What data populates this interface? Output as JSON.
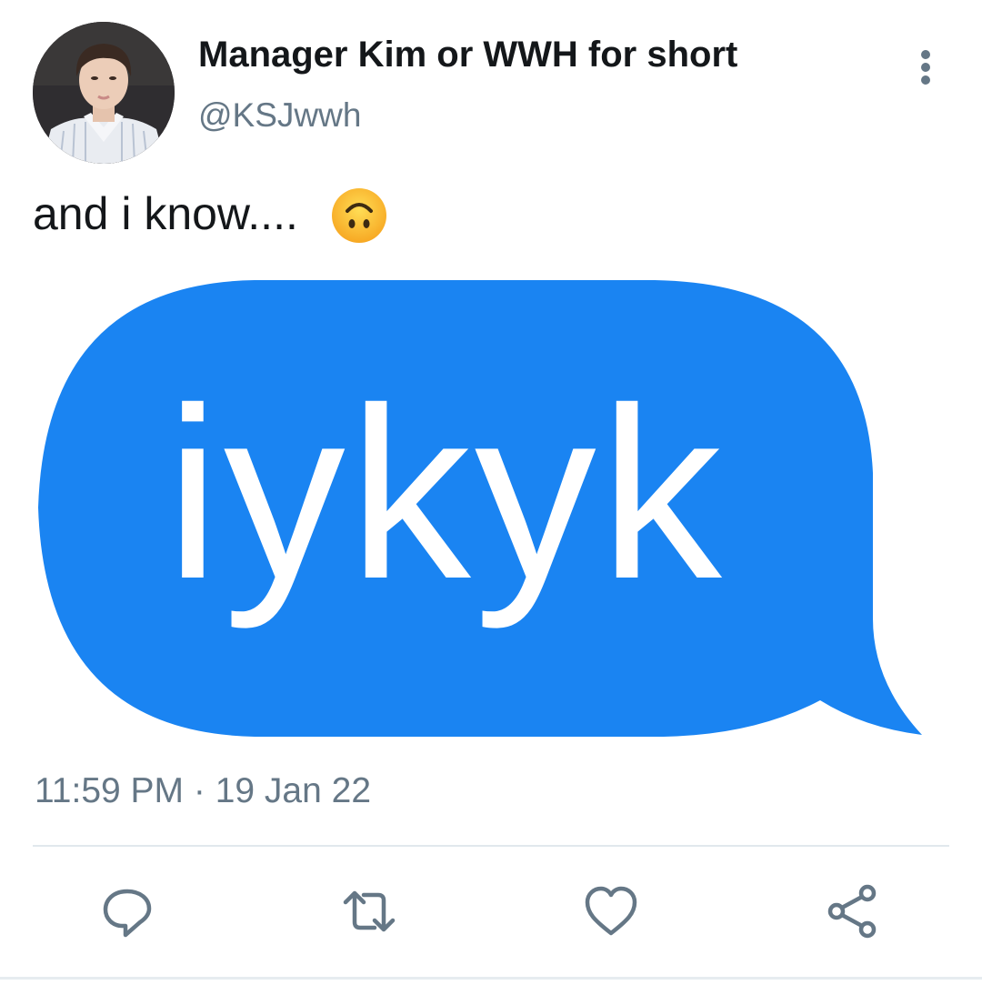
{
  "tweet": {
    "display_name": "Manager Kim or WWH for short",
    "handle": "@KSJwwh",
    "text": "and i know....",
    "emoji": "upside-down-face",
    "media_text": "iykyk",
    "timestamp": "11:59 PM · 19 Jan 22"
  },
  "icons": {
    "more": "more-vertical-icon",
    "reply": "reply-icon",
    "retweet": "retweet-icon",
    "like": "heart-icon",
    "share": "share-icon"
  },
  "colors": {
    "bubble": "#1a84f2",
    "secondary_text": "#657786",
    "primary_text": "#14171a",
    "icon": "#657786"
  }
}
